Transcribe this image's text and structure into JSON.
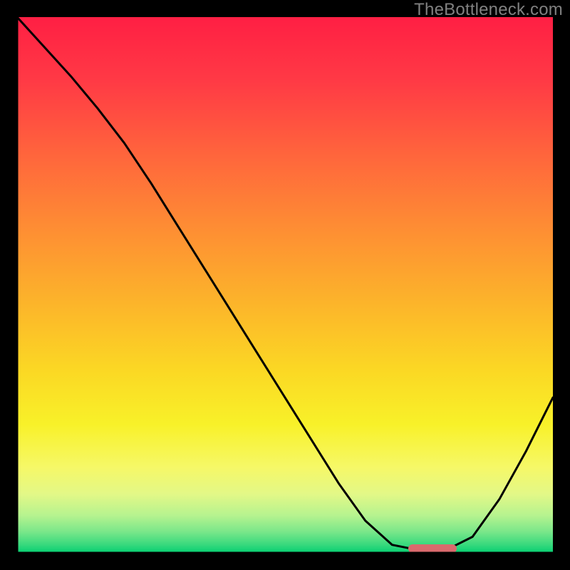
{
  "watermark": "TheBottleneck.com",
  "colors": {
    "background": "#000000",
    "axis": "#000000",
    "curve": "#000000",
    "marker": "#da6a6d",
    "gradient_top": "#ff1f44",
    "gradient_bottom": "#05cf71"
  },
  "chart_data": {
    "type": "line",
    "title": "",
    "xlabel": "",
    "ylabel": "",
    "xlim": [
      0,
      100
    ],
    "ylim": [
      0,
      100
    ],
    "x": [
      0,
      5,
      10,
      15,
      20,
      25,
      30,
      35,
      40,
      45,
      50,
      55,
      60,
      65,
      70,
      75,
      80,
      85,
      90,
      95,
      100
    ],
    "values": [
      100,
      94.5,
      89,
      83,
      76.5,
      69,
      61,
      53,
      45,
      37,
      29,
      21,
      13,
      6,
      1.5,
      0.5,
      0.5,
      3,
      10,
      19,
      29
    ],
    "marker": {
      "x_start": 73,
      "x_end": 82,
      "y": 0.8
    },
    "notes": "y-values are approximate (read from the plotted curve shape); 100 = top of the gradient region, 0 = bottom. The curve minimum lies roughly at x≈75–80."
  }
}
